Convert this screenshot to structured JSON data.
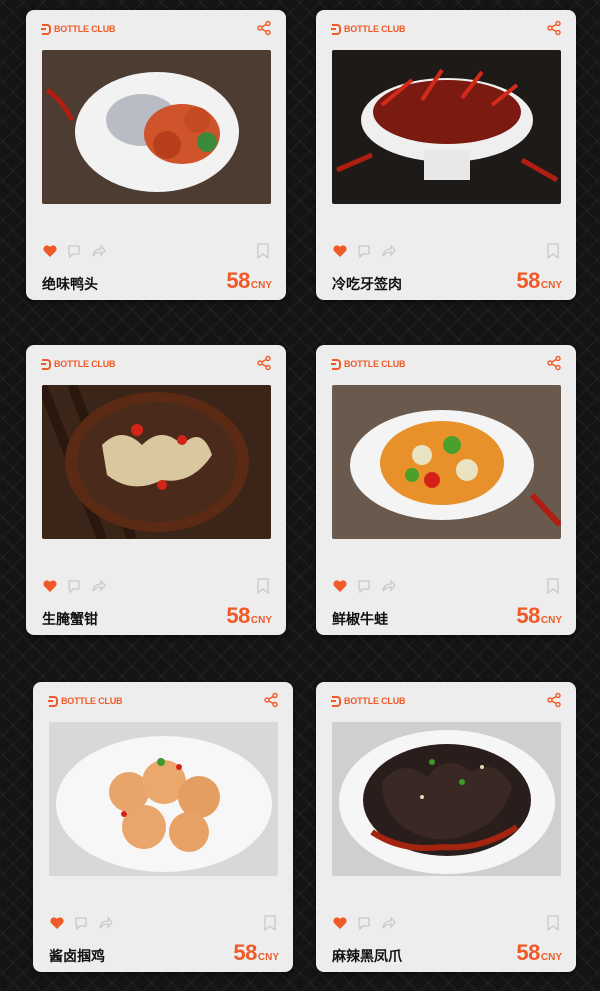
{
  "brand": "BOTTLE CLUB",
  "accent": "#f05a28",
  "icons": [
    "heart-icon",
    "comment-icon",
    "share-arrow-icon",
    "bookmark-icon",
    "share-icon"
  ],
  "cards": [
    {
      "name": "绝味鸭头",
      "price": "58",
      "currency": "CNY"
    },
    {
      "name": "冷吃牙签肉",
      "price": "58",
      "currency": "CNY"
    },
    {
      "name": "生腌蟹钳",
      "price": "58",
      "currency": "CNY"
    },
    {
      "name": "鲜椒牛蛙",
      "price": "58",
      "currency": "CNY"
    },
    {
      "name": "酱卤掴鸡",
      "price": "58",
      "currency": "CNY"
    },
    {
      "name": "麻辣黑凤爪",
      "price": "58",
      "currency": "CNY"
    }
  ]
}
